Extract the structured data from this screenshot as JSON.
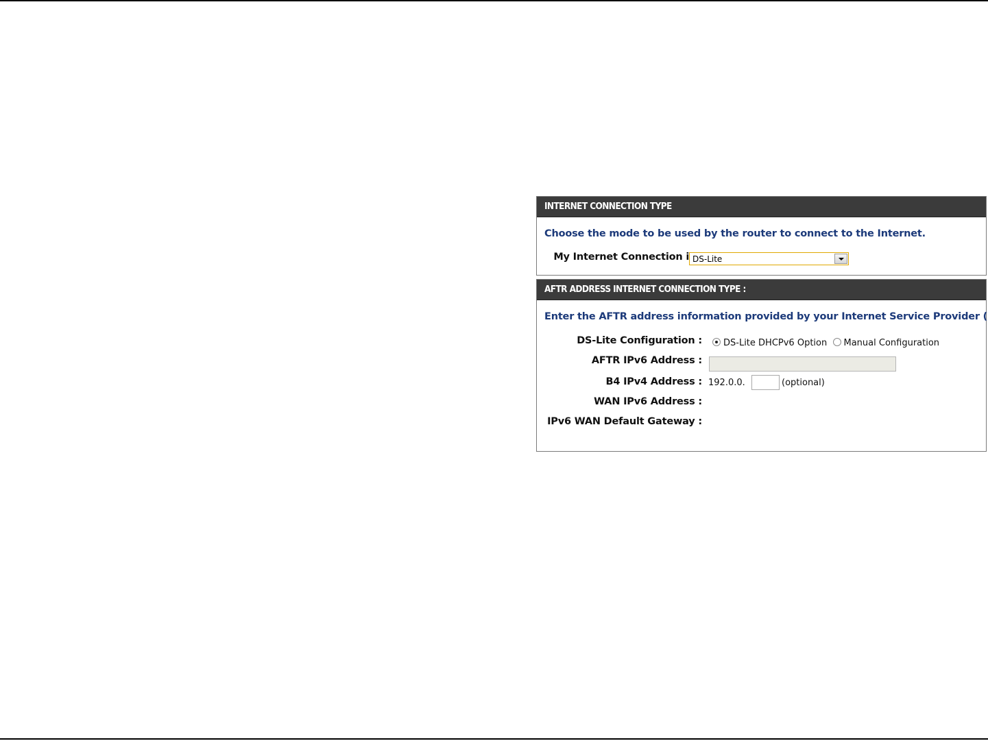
{
  "section1": {
    "title": "INTERNET CONNECTION TYPE",
    "description": "Choose the mode to be used by the router to connect to the Internet.",
    "connection_label": "My Internet Connection is :",
    "connection_value": "DS-Lite"
  },
  "section2": {
    "title": "AFTR ADDRESS INTERNET CONNECTION TYPE :",
    "description": "Enter the AFTR address information provided by your Internet Service Provider (ISP).",
    "dslite_config_label": "DS-Lite Configuration :",
    "option_dhcpv6": "DS-Lite DHCPv6 Option",
    "option_manual": "Manual Configuration",
    "selected_option": "DS-Lite DHCPv6 Option",
    "aftr_label": "AFTR IPv6 Address :",
    "aftr_value": "",
    "b4_label": "B4 IPv4 Address :",
    "b4_prefix": "192.0.0.",
    "b4_value": "",
    "b4_optional": "(optional)",
    "wan_ipv6_label": "WAN IPv6 Address :",
    "wan_ipv6_value": "",
    "gateway_label": "IPv6 WAN Default Gateway :",
    "gateway_value": ""
  }
}
